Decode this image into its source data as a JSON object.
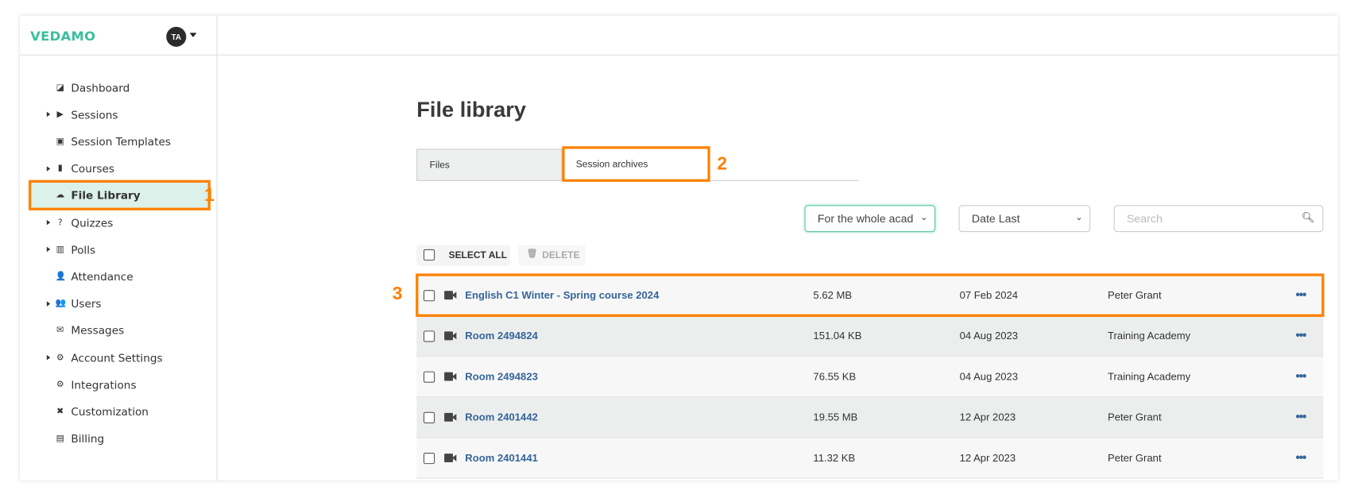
{
  "app": {
    "logo": "VEDAMO",
    "avatar_initials": "TA"
  },
  "sidebar": {
    "items": [
      {
        "label": "Dashboard",
        "icon": "dashboard-icon",
        "expandable": false
      },
      {
        "label": "Sessions",
        "icon": "play-circle-icon",
        "expandable": true
      },
      {
        "label": "Session Templates",
        "icon": "template-icon",
        "expandable": false
      },
      {
        "label": "Courses",
        "icon": "book-icon",
        "expandable": true
      },
      {
        "label": "File Library",
        "icon": "cloud-upload-icon",
        "expandable": false,
        "active": true
      },
      {
        "label": "Quizzes",
        "icon": "question-circle-icon",
        "expandable": true
      },
      {
        "label": "Polls",
        "icon": "bar-chart-icon",
        "expandable": true
      },
      {
        "label": "Attendance",
        "icon": "user-clock-icon",
        "expandable": false
      },
      {
        "label": "Users",
        "icon": "users-icon",
        "expandable": true
      },
      {
        "label": "Messages",
        "icon": "envelope-icon",
        "expandable": false
      },
      {
        "label": "Account Settings",
        "icon": "gear-icon",
        "expandable": true
      },
      {
        "label": "Integrations",
        "icon": "cogs-icon",
        "expandable": false
      },
      {
        "label": "Customization",
        "icon": "tools-icon",
        "expandable": false
      },
      {
        "label": "Billing",
        "icon": "invoice-icon",
        "expandable": false
      }
    ]
  },
  "annotations": {
    "one": "1",
    "two": "2",
    "three": "3",
    "color": "#ff8000"
  },
  "main": {
    "title": "File library",
    "tabs": [
      {
        "label": "Files"
      },
      {
        "label": "Session archives",
        "active": true
      }
    ],
    "filters": {
      "period": "For the whole acad",
      "sort": "Date Last",
      "search_placeholder": "Search"
    },
    "actions": {
      "select_all": "SELECT ALL",
      "delete": "DELETE"
    },
    "rows": [
      {
        "name": "English C1 Winter - Spring course 2024",
        "size": "5.62 MB",
        "date": "07 Feb 2024",
        "owner": "Peter Grant"
      },
      {
        "name": "Room 2494824",
        "size": "151.04 KB",
        "date": "04 Aug 2023",
        "owner": "Training Academy"
      },
      {
        "name": "Room 2494823",
        "size": "76.55 KB",
        "date": "04 Aug 2023",
        "owner": "Training Academy"
      },
      {
        "name": "Room 2401442",
        "size": "19.55 MB",
        "date": "12 Apr 2023",
        "owner": "Peter Grant"
      },
      {
        "name": "Room 2401441",
        "size": "11.32 KB",
        "date": "12 Apr 2023",
        "owner": "Peter Grant"
      }
    ],
    "more_icon": "•••"
  },
  "colors": {
    "brand": "#3dbd9e",
    "link": "#36659a",
    "active_bg": "#dcf1e9"
  }
}
